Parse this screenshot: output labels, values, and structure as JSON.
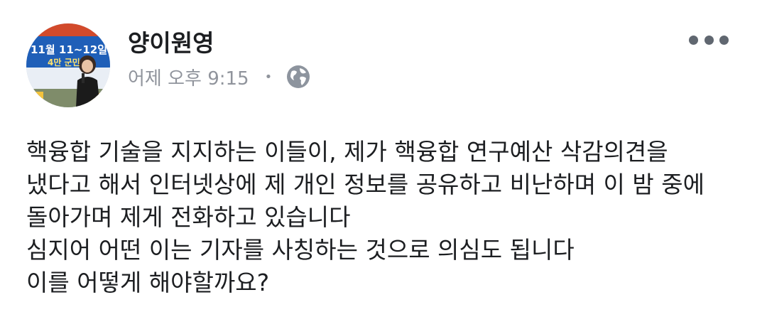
{
  "post": {
    "author": "양이원영",
    "timestamp": "어제 오후 9:15",
    "separator": "•",
    "privacy_icon": "globe-icon",
    "menu_icon": "more-options-icon",
    "avatar": {
      "banner_line1": "11월 11~12일",
      "banner_line2": "4만 군민"
    },
    "body_lines": [
      "핵융합 기술을 지지하는 이들이, 제가 핵융합 연구예산 삭감의견을",
      "냈다고 해서 인터넷상에 제 개인 정보를 공유하고 비난하며 이 밤 중에",
      "돌아가며 제게 전화하고 있습니다",
      "심지어 어떤 이는 기자를 사칭하는 것으로 의심도 됩니다",
      "이를 어떻게 해야할까요?"
    ]
  },
  "colors": {
    "author_text": "#1c1e21",
    "meta_text": "#90949c",
    "icon_gray": "#606770"
  }
}
